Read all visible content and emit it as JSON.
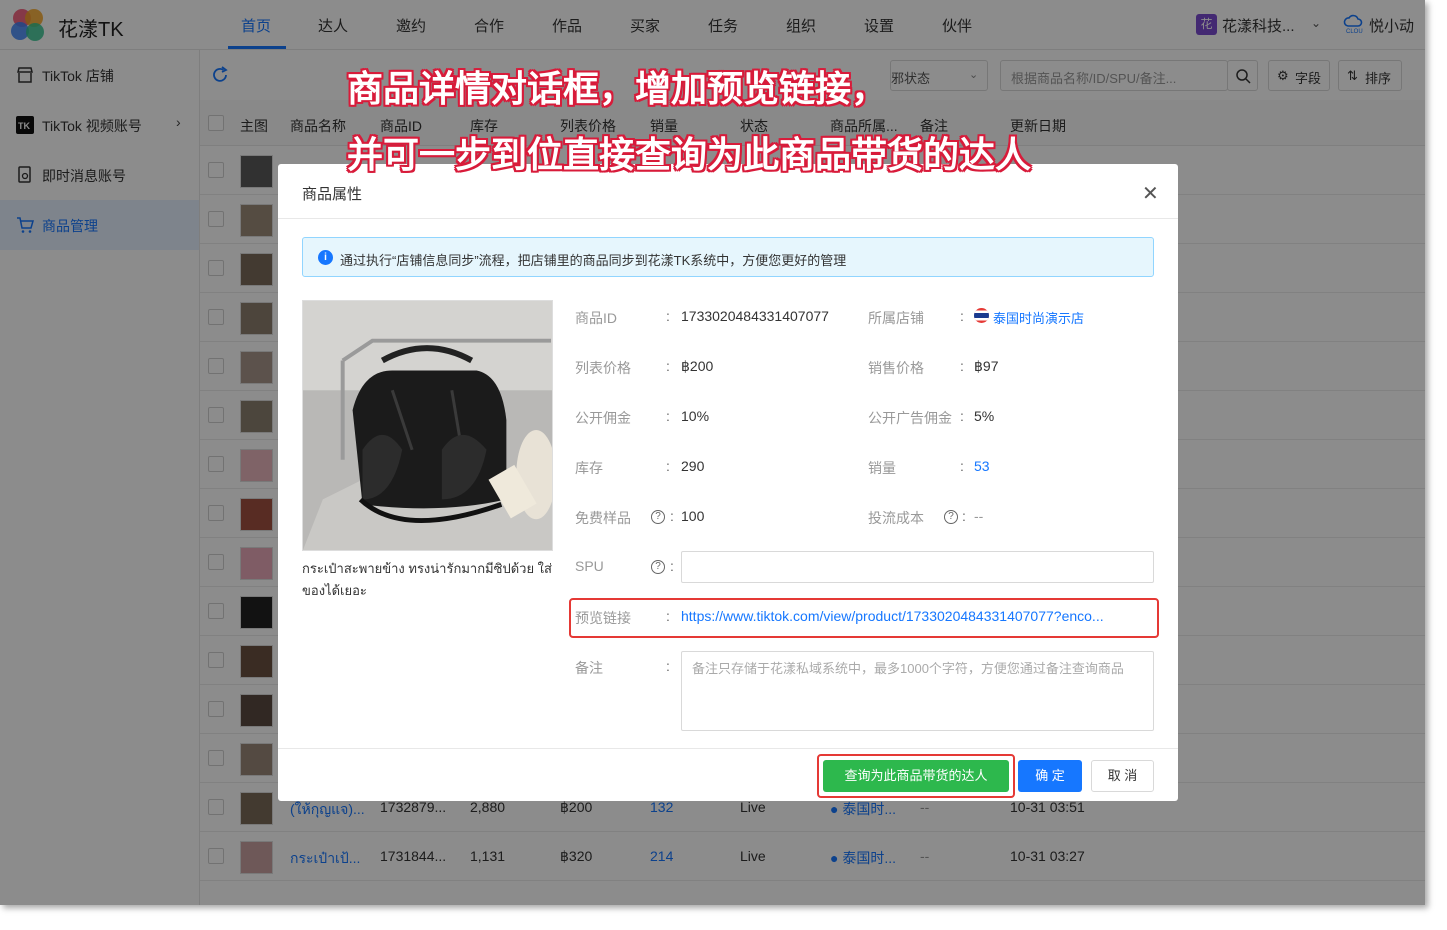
{
  "app": {
    "brand": "花漾TK"
  },
  "nav": [
    "首页",
    "达人",
    "邀约",
    "合作",
    "作品",
    "买家",
    "任务",
    "组织",
    "设置",
    "伙伴"
  ],
  "nav_active": "首页",
  "org": {
    "badge": "花",
    "name": "花漾科技..."
  },
  "user": {
    "name": "悦小动"
  },
  "sidebar": [
    {
      "label": "TikTok 店铺",
      "icon": "store-icon"
    },
    {
      "label": "TikTok 视频账号",
      "icon": "tiktok-icon"
    },
    {
      "label": "即时消息账号",
      "icon": "message-icon"
    },
    {
      "label": "商品管理",
      "icon": "cart-icon",
      "active": true
    }
  ],
  "toolbar": {
    "status_placeholder": "邪状态",
    "search_placeholder": "根据商品名称/ID/SPU/备注...",
    "field_label": "字段",
    "sort_label": "排序"
  },
  "table": {
    "headers": [
      "主图",
      "商品名称",
      "商品ID",
      "库存",
      "列表价格",
      "销量",
      "状态",
      "商品所属...",
      "备注",
      "更新日期"
    ],
    "visible_rows": [
      {
        "name": "(ให้กุญแจ)...",
        "id": "1732879...",
        "stock": "2,880",
        "price": "฿200",
        "sales": "132",
        "status": "Live",
        "shop": "泰国时...",
        "remark": "--",
        "date": "10-31 03:51"
      },
      {
        "name": "กระเป๋าเป้...",
        "id": "1731844...",
        "stock": "1,131",
        "price": "฿320",
        "sales": "214",
        "status": "Live",
        "shop": "泰国时...",
        "remark": "--",
        "date": "10-31 03:27"
      }
    ]
  },
  "modal": {
    "title": "商品属性",
    "info": "通过执行“店铺信息同步”流程，把店铺里的商品同步到花漾TK系统中，方便您更好的管理",
    "caption": "กระเป๋าสะพายข้าง ทรงน่ารักมากมีซิปด้วย ใส่ของได้เยอะ",
    "fields": {
      "product_id": {
        "label": "商品ID",
        "value": "1733020484331407077"
      },
      "shop": {
        "label": "所属店铺",
        "value": "泰国时尚演示店"
      },
      "list_price": {
        "label": "列表价格",
        "value": "฿200"
      },
      "sale_price": {
        "label": "销售价格",
        "value": "฿97"
      },
      "commission": {
        "label": "公开佣金",
        "value": "10%"
      },
      "ad_commission": {
        "label": "公开广告佣金",
        "value": "5%"
      },
      "stock": {
        "label": "库存",
        "value": "290"
      },
      "sales": {
        "label": "销量",
        "value": "53"
      },
      "free_sample": {
        "label": "免费样品",
        "value": "100"
      },
      "traffic_cost": {
        "label": "投流成本",
        "value": "--"
      },
      "spu": {
        "label": "SPU",
        "value": ""
      },
      "preview": {
        "label": "预览链接",
        "value": "https://www.tiktok.com/view/product/1733020484331407077?enco..."
      },
      "remark": {
        "label": "备注",
        "placeholder": "备注只存储于花漾私域系统中，最多1000个字符，方便您通过备注查询商品"
      }
    },
    "buttons": {
      "query": "查询为此商品带货的达人",
      "ok": "确 定",
      "cancel": "取 消"
    }
  },
  "annotation": {
    "line1": "商品详情对话框，增加预览链接，",
    "line2": "并可一步到位直接查询为此商品带货的达人"
  },
  "colors": {
    "accent": "#1677ff",
    "highlight": "#e53935",
    "query_btn": "#2db84d"
  }
}
